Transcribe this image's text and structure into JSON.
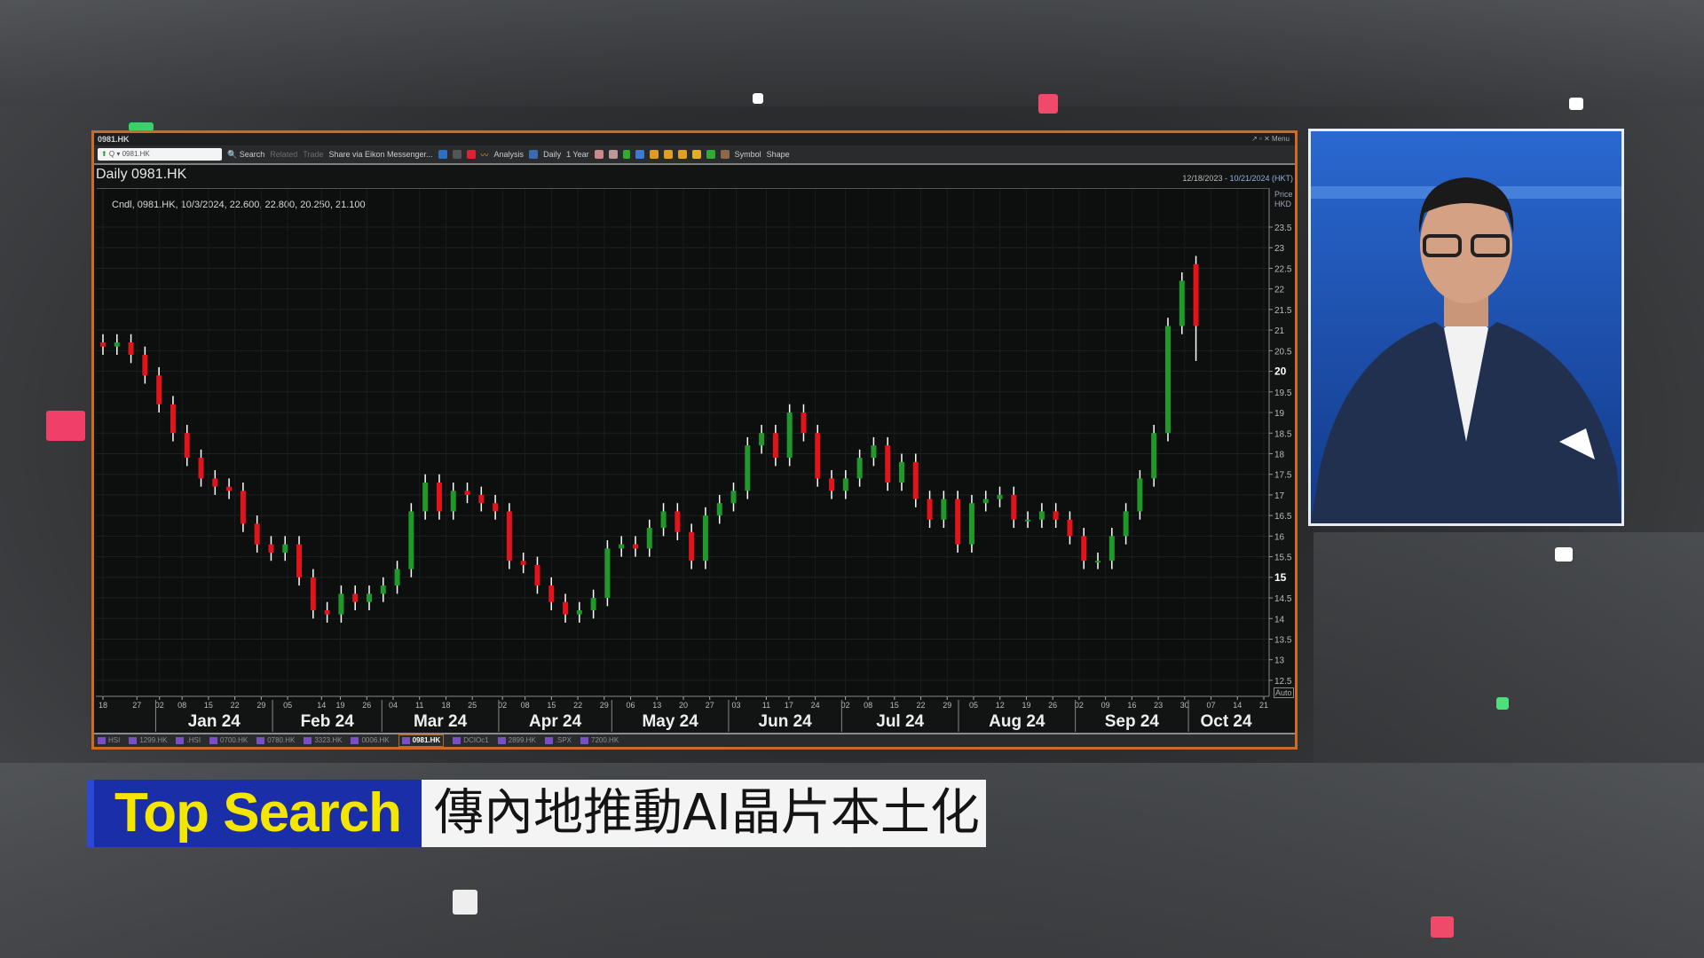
{
  "window": {
    "title": "0981.HK",
    "controls": "↗ ▫ ✕ Menu",
    "border_color": "#cf6a22"
  },
  "toolbar": {
    "ric_value": "0981.HK",
    "search": "Search",
    "related": "Related",
    "trade": "Trade",
    "share": "Share via Eikon Messenger...",
    "analysis": "Analysis",
    "interval": "Daily",
    "period": "1 Year",
    "symbol": "Symbol",
    "shape": "Shape"
  },
  "chart_header": {
    "title": "Daily 0981.HK",
    "range_start": "12/18/2023",
    "range_sep": " - ",
    "range_end": "10/21/2024 (HKT)",
    "readout": "Cndl, 0981.HK, 10/3/2024, 22.600, 22.800, 20.250, 21.100",
    "price_label": "Price",
    "currency": "HKD",
    "auto": "Auto"
  },
  "ticker_tabs": [
    "HSI",
    "1299.HK",
    ".HSI",
    "0700.HK",
    "0780.HK",
    "3323.HK",
    "0006.HK",
    "0981.HK",
    "DCIOc1",
    "2899.HK",
    ".SPX",
    "7200.HK"
  ],
  "active_tab": "0981.HK",
  "chart_data": {
    "type": "candlestick",
    "title": "Daily 0981.HK",
    "ylabel": "Price HKD",
    "ylim": [
      12.5,
      23.5
    ],
    "yticks": [
      12.5,
      13,
      13.5,
      14,
      14.5,
      15,
      15.5,
      16,
      16.5,
      17,
      17.5,
      18,
      18.5,
      19,
      19.5,
      20,
      20.5,
      21,
      21.5,
      22,
      22.5,
      23,
      23.5
    ],
    "x_range": [
      "2023-12-18",
      "2024-10-21"
    ],
    "data_range": [
      "2023-12-18",
      "2024-10-03"
    ],
    "grid": true,
    "colors": {
      "up": "#1f9a2a",
      "down": "#e0141a",
      "wick": "#ffffff"
    },
    "day_ticks": [
      [
        "2023-12-18",
        "18"
      ],
      [
        "2023-12-27",
        "27"
      ],
      [
        "2024-01-02",
        "02"
      ],
      [
        "2024-01-08",
        "08"
      ],
      [
        "2024-01-15",
        "15"
      ],
      [
        "2024-01-22",
        "22"
      ],
      [
        "2024-01-29",
        "29"
      ],
      [
        "2024-02-05",
        "05"
      ],
      [
        "2024-02-14",
        "14"
      ],
      [
        "2024-02-19",
        "19"
      ],
      [
        "2024-02-26",
        "26"
      ],
      [
        "2024-03-04",
        "04"
      ],
      [
        "2024-03-11",
        "11"
      ],
      [
        "2024-03-18",
        "18"
      ],
      [
        "2024-03-25",
        "25"
      ],
      [
        "2024-04-02",
        "02"
      ],
      [
        "2024-04-08",
        "08"
      ],
      [
        "2024-04-15",
        "15"
      ],
      [
        "2024-04-22",
        "22"
      ],
      [
        "2024-04-29",
        "29"
      ],
      [
        "2024-05-06",
        "06"
      ],
      [
        "2024-05-13",
        "13"
      ],
      [
        "2024-05-20",
        "20"
      ],
      [
        "2024-05-27",
        "27"
      ],
      [
        "2024-06-03",
        "03"
      ],
      [
        "2024-06-11",
        "11"
      ],
      [
        "2024-06-17",
        "17"
      ],
      [
        "2024-06-24",
        "24"
      ],
      [
        "2024-07-02",
        "02"
      ],
      [
        "2024-07-08",
        "08"
      ],
      [
        "2024-07-15",
        "15"
      ],
      [
        "2024-07-22",
        "22"
      ],
      [
        "2024-07-29",
        "29"
      ],
      [
        "2024-08-05",
        "05"
      ],
      [
        "2024-08-12",
        "12"
      ],
      [
        "2024-08-19",
        "19"
      ],
      [
        "2024-08-26",
        "26"
      ],
      [
        "2024-09-02",
        "02"
      ],
      [
        "2024-09-09",
        "09"
      ],
      [
        "2024-09-16",
        "16"
      ],
      [
        "2024-09-23",
        "23"
      ],
      [
        "2024-09-30",
        "30"
      ],
      [
        "2024-10-07",
        "07"
      ],
      [
        "2024-10-14",
        "14"
      ],
      [
        "2024-10-21",
        "21"
      ]
    ],
    "months": [
      [
        "2024-01-01",
        "Jan 24"
      ],
      [
        "2024-02-01",
        "Feb 24"
      ],
      [
        "2024-03-01",
        "Mar 24"
      ],
      [
        "2024-04-01",
        "Apr 24"
      ],
      [
        "2024-05-01",
        "May 24"
      ],
      [
        "2024-06-01",
        "Jun 24"
      ],
      [
        "2024-07-01",
        "Jul 24"
      ],
      [
        "2024-08-01",
        "Aug 24"
      ],
      [
        "2024-09-01",
        "Sep 24"
      ],
      [
        "2024-10-01",
        "Oct 24"
      ]
    ],
    "closes": [
      20.6,
      20.7,
      20.4,
      19.9,
      19.2,
      18.5,
      17.9,
      17.4,
      17.2,
      17.1,
      16.3,
      15.8,
      15.6,
      15.8,
      15.0,
      14.2,
      14.1,
      14.6,
      14.4,
      14.6,
      14.8,
      15.2,
      16.6,
      17.3,
      16.6,
      17.1,
      17.0,
      16.8,
      16.6,
      15.4,
      15.3,
      14.8,
      14.4,
      14.1,
      14.2,
      14.5,
      15.7,
      15.8,
      15.7,
      16.2,
      16.6,
      16.1,
      15.4,
      16.5,
      16.8,
      17.1,
      18.2,
      18.5,
      17.9,
      19.0,
      18.5,
      17.4,
      17.1,
      17.4,
      17.9,
      18.2,
      17.3,
      17.8,
      16.9,
      16.4,
      16.9,
      15.8,
      16.8,
      16.9,
      17.0,
      16.4,
      16.4,
      16.6,
      16.4,
      16.0,
      15.4,
      15.4,
      16.0,
      16.6,
      17.4,
      18.5,
      21.1,
      22.2,
      21.1
    ],
    "last_candle": {
      "date": "2024-10-03",
      "open": 22.6,
      "high": 22.8,
      "low": 20.25,
      "close": 21.1
    }
  },
  "caption": {
    "tag": "Top Search",
    "headline": "傳內地推動AI晶片本土化",
    "tag_bg": "#1a2ea8",
    "tag_color": "#f5e600"
  }
}
